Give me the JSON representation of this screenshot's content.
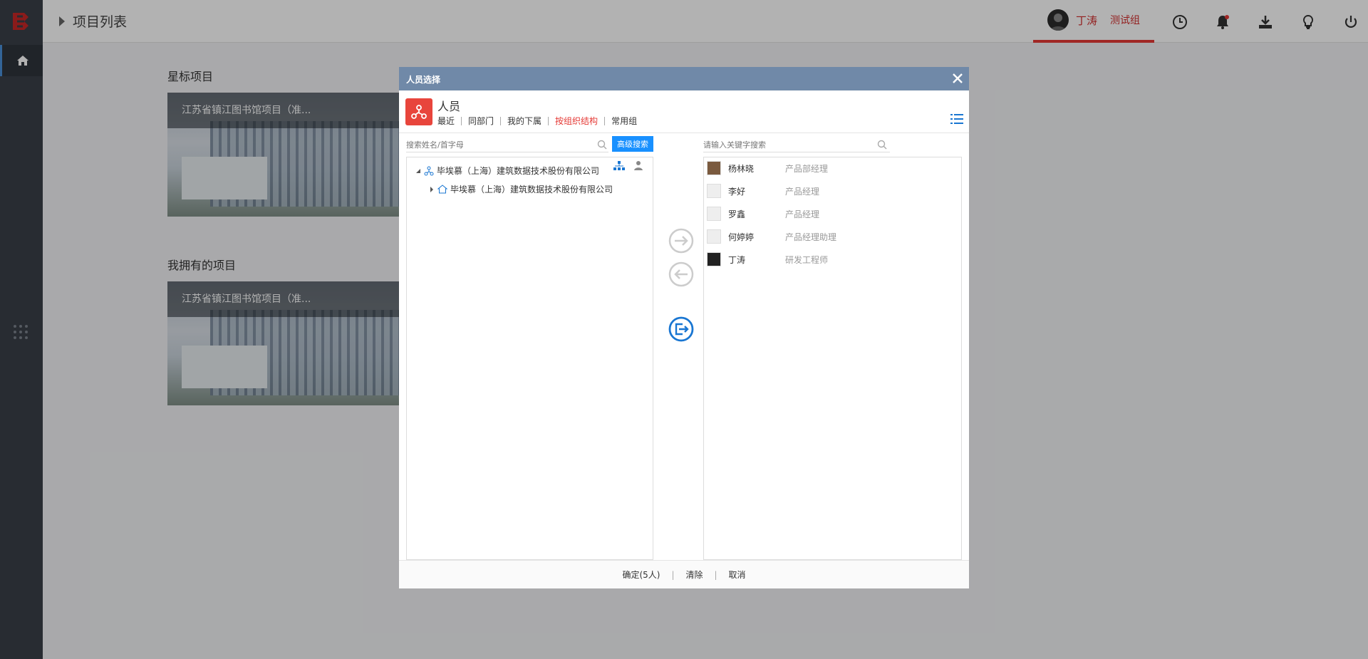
{
  "header": {
    "breadcrumb_title": "项目列表",
    "user_name": "丁涛",
    "user_group": "测试组"
  },
  "main": {
    "starred_title": "星标项目",
    "owned_title": "我拥有的项目",
    "starred_card_title": "江苏省镇江图书馆项目（准...",
    "owned_card_title": "江苏省镇江图书馆项目（准..."
  },
  "dialog": {
    "title": "人员选择",
    "panel_title": "人员",
    "tabs": [
      "最近",
      "同部门",
      "我的下属",
      "按组织结构",
      "常用组"
    ],
    "active_tab": "按组织结构",
    "search_left_placeholder": "搜索姓名/首字母",
    "advanced_search_label": "高级搜索",
    "search_right_placeholder": "请输入关键字搜索",
    "tree": [
      {
        "label": "毕埃慕（上海）建筑数据技术股份有限公司",
        "expanded": true
      },
      {
        "label": "毕埃慕（上海）建筑数据技术股份有限公司",
        "expanded": false
      }
    ],
    "selected_people": [
      {
        "name": "杨林晓",
        "role": "产品部经理"
      },
      {
        "name": "李好",
        "role": "产品经理"
      },
      {
        "name": "罗鑫",
        "role": "产品经理"
      },
      {
        "name": "何婷婷",
        "role": "产品经理助理"
      },
      {
        "name": "丁涛",
        "role": "研发工程师"
      }
    ],
    "confirm_label": "确定(5人)",
    "clear_label": "清除",
    "cancel_label": "取消"
  },
  "colors": {
    "accent_red": "#e53935",
    "dialog_header": "#7089a8",
    "button_blue": "#1890ff",
    "sidebar": "#3a3f48"
  }
}
